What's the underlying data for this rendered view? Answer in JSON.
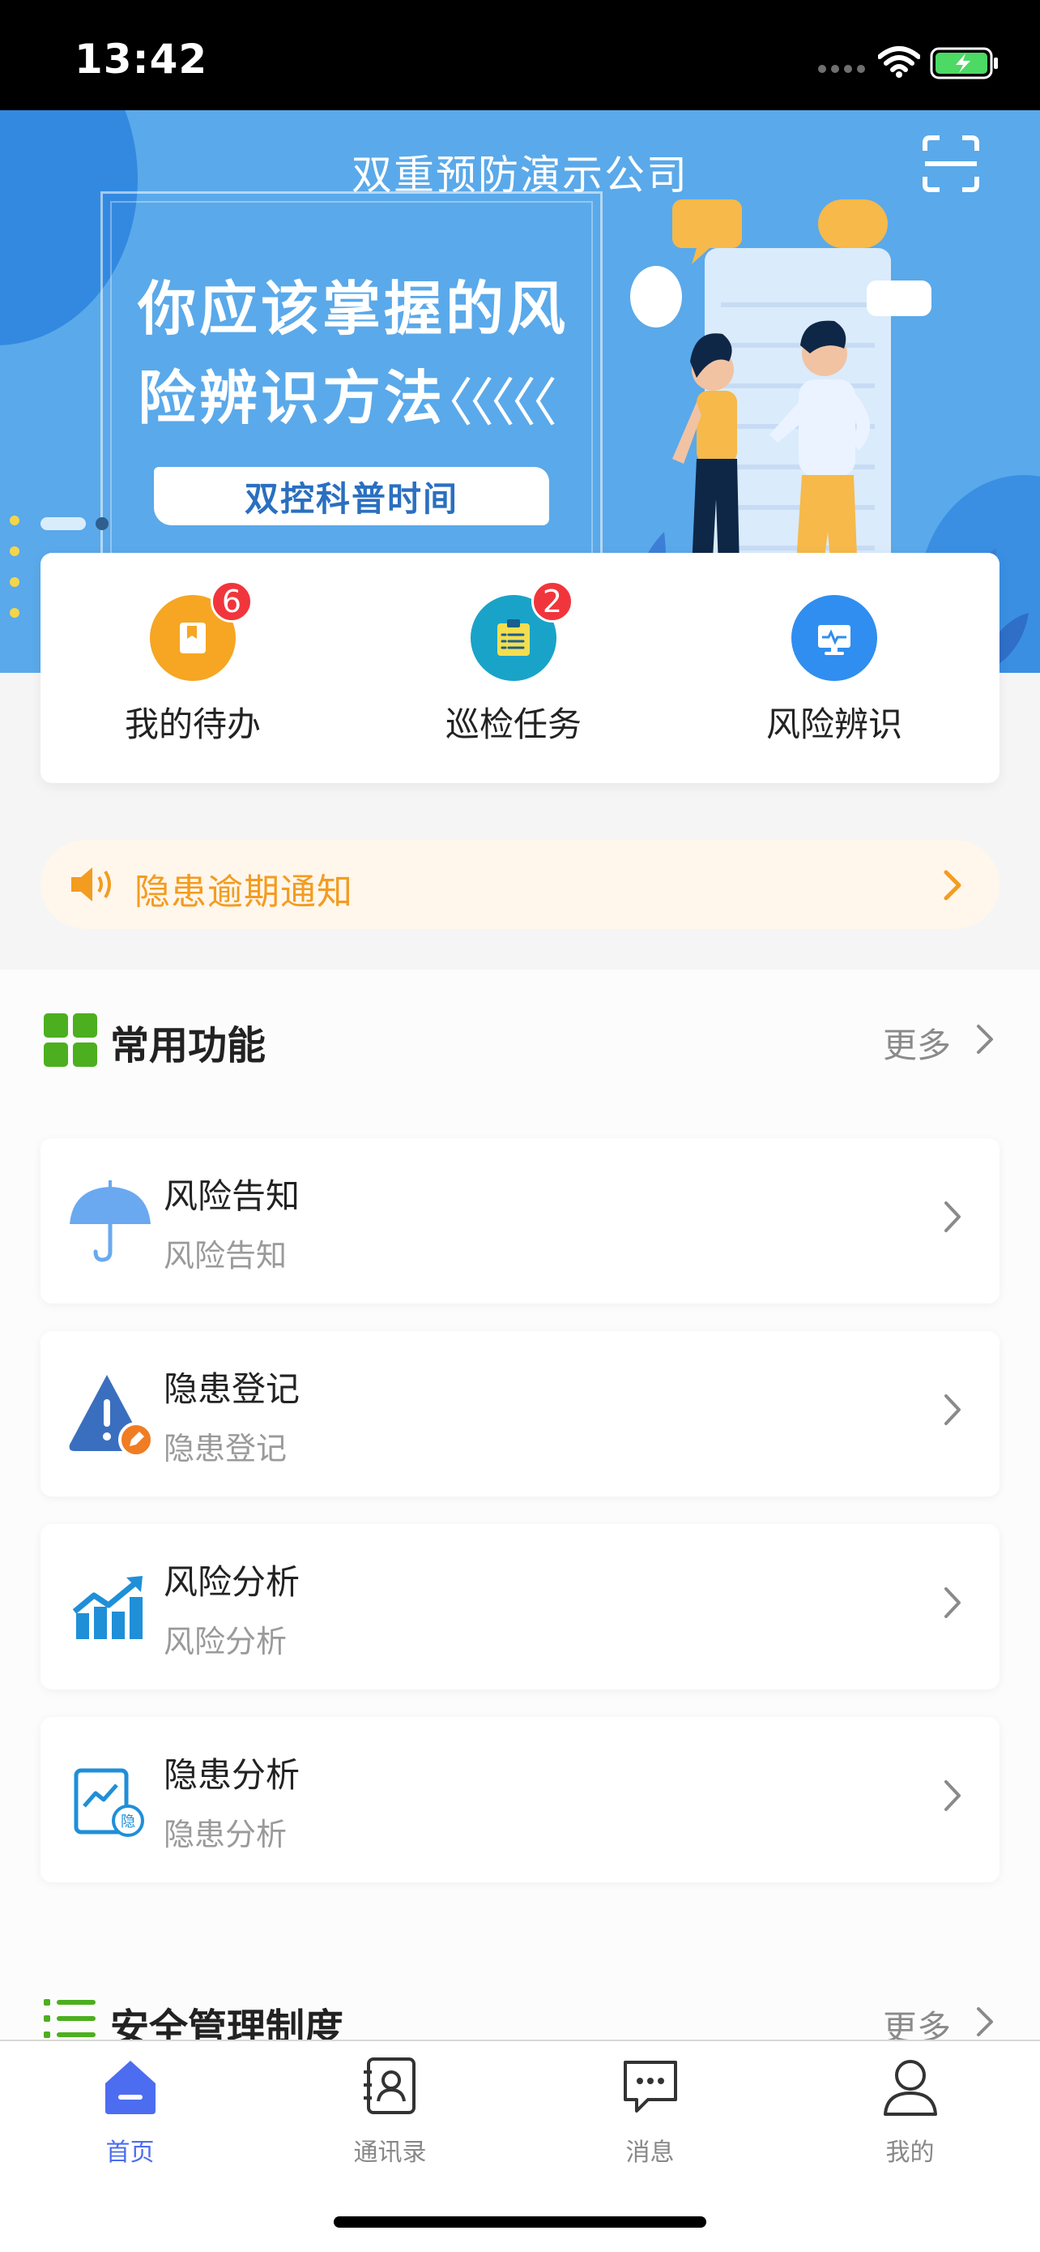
{
  "status_bar": {
    "time": "13:42"
  },
  "banner": {
    "company": "双重预防演示公司",
    "headline_line1": "你应该掌握的风",
    "headline_line2": "险辨识方法",
    "chevrons": "〈〈〈〈〈",
    "subtitle": "双控科普时间"
  },
  "quick_actions": [
    {
      "label": "我的待办",
      "badge": "6",
      "color": "#f6a623",
      "icon": "bookmark-icon"
    },
    {
      "label": "巡检任务",
      "badge": "2",
      "color": "#1aa3c8",
      "icon": "checklist-icon"
    },
    {
      "label": "风险辨识",
      "badge": "",
      "color": "#2f8ef0",
      "icon": "monitor-icon"
    }
  ],
  "notice": {
    "text": "隐患逾期通知"
  },
  "common": {
    "title": "常用功能",
    "more": "更多",
    "items": [
      {
        "title": "风险告知",
        "subtitle": "风险告知",
        "icon": "umbrella-icon"
      },
      {
        "title": "隐患登记",
        "subtitle": "隐患登记",
        "icon": "warning-edit-icon"
      },
      {
        "title": "风险分析",
        "subtitle": "风险分析",
        "icon": "chart-growth-icon"
      },
      {
        "title": "隐患分析",
        "subtitle": "隐患分析",
        "icon": "report-analysis-icon"
      }
    ]
  },
  "safety": {
    "title": "安全管理制度",
    "more": "更多"
  },
  "tabs": [
    {
      "label": "首页",
      "icon": "home-icon",
      "active": true
    },
    {
      "label": "通讯录",
      "icon": "contacts-icon",
      "active": false
    },
    {
      "label": "消息",
      "icon": "message-icon",
      "active": false
    },
    {
      "label": "我的",
      "icon": "user-icon",
      "active": false
    }
  ],
  "colors": {
    "accent": "#4d6df0",
    "banner": "#5aa9ea",
    "notice": "#f39c1f",
    "badge": "#f0363c"
  }
}
